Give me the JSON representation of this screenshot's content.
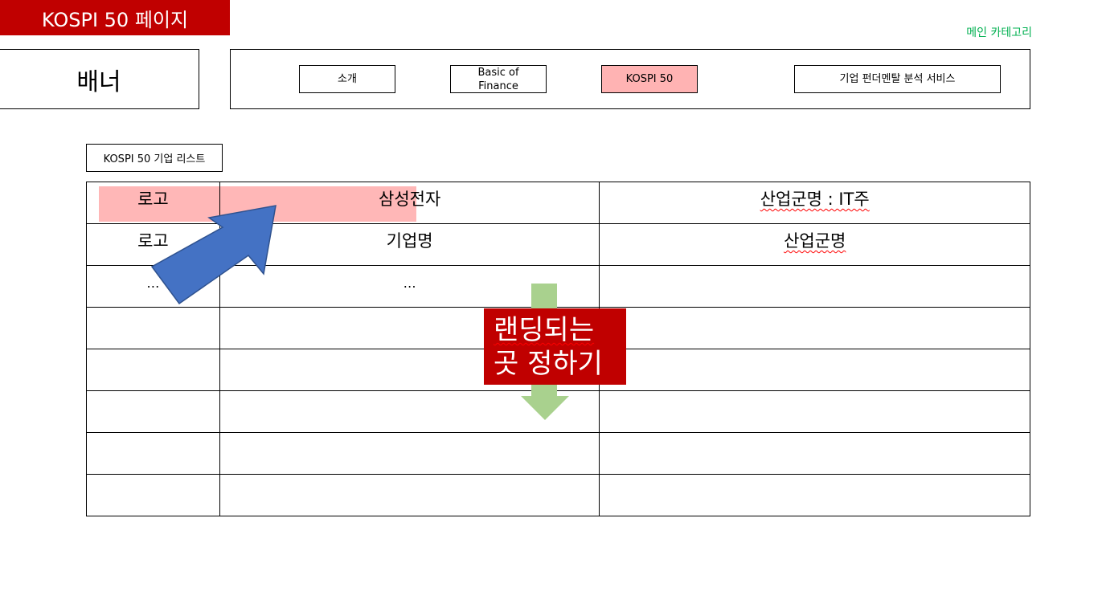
{
  "page_title": "KOSPI 50 페이지",
  "main_category_label": "메인 카테고리",
  "banner": "배너",
  "nav": [
    {
      "label": "소개",
      "active": false
    },
    {
      "label": "Basic of Finance",
      "active": false
    },
    {
      "label": "KOSPI 50",
      "active": true
    },
    {
      "label": "기업 펀더멘탈 분석 서비스",
      "active": false
    }
  ],
  "list_label": "KOSPI 50 기업 리스트",
  "table": {
    "rows": [
      [
        "로고",
        "삼성전자",
        "산업군명 : IT주"
      ],
      [
        "로고",
        "기업명",
        "산업군명"
      ],
      [
        "…",
        "…",
        ""
      ],
      [
        "",
        "",
        ""
      ],
      [
        "",
        "",
        ""
      ],
      [
        "",
        "",
        ""
      ],
      [
        "",
        "",
        ""
      ],
      [
        "",
        "",
        ""
      ]
    ]
  },
  "callout": {
    "line1": "랜딩되는",
    "line2": "곳 정하기"
  },
  "colors": {
    "title_bg": "#c00000",
    "highlight": "#ffb3b3",
    "arrow_blue": "#4472c4",
    "arrow_green": "#a9d18e",
    "category_green": "#00b050"
  }
}
